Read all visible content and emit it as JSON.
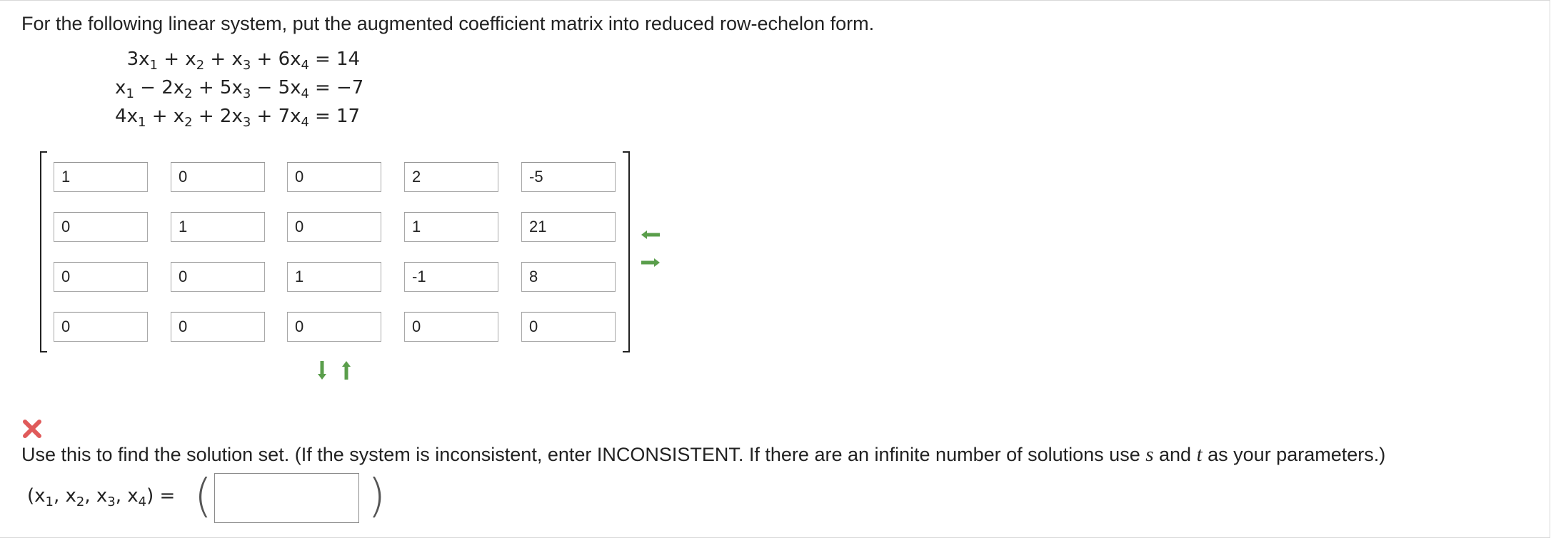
{
  "prompt": "For the following linear system, put the augmented coefficient matrix into reduced row-echelon form.",
  "system": {
    "equations": [
      {
        "lhs_html": "3x<span class='sub'>1</span> + x<span class='sub'>2</span> + x<span class='sub'>3</span> + 6x<span class='sub'>4</span>",
        "eq": "=",
        "rhs": "14"
      },
      {
        "lhs_html": "x<span class='sub'>1</span> − 2x<span class='sub'>2</span> + 5x<span class='sub'>3</span> − 5x<span class='sub'>4</span>",
        "eq": "=",
        "rhs": "−7"
      },
      {
        "lhs_html": "4x<span class='sub'>1</span> + x<span class='sub'>2</span> + 2x<span class='sub'>3</span> + 7x<span class='sub'>4</span>",
        "eq": "=",
        "rhs": "17"
      }
    ]
  },
  "matrix": {
    "rows": [
      [
        "1",
        "0",
        "0",
        "2",
        "-5"
      ],
      [
        "0",
        "1",
        "0",
        "1",
        "21"
      ],
      [
        "0",
        "0",
        "1",
        "-1",
        "8"
      ],
      [
        "0",
        "0",
        "0",
        "0",
        "0"
      ]
    ]
  },
  "controls": {
    "remove_column_icon": "left-arrow-icon",
    "add_column_icon": "right-arrow-icon",
    "add_row_icon": "down-arrow-icon",
    "remove_row_icon": "up-arrow-icon",
    "arrow_color": "#5a9e4b"
  },
  "feedback": {
    "icon": "incorrect-x-icon",
    "color": "#e05a5a"
  },
  "instruction": {
    "part1": "Use this to find the solution set. (If the system is inconsistent, enter INCONSISTENT. If there are an infinite number of solutions use ",
    "var_s": "s",
    "part2": " and ",
    "var_t": "t",
    "part3": " as your parameters.)"
  },
  "answer": {
    "label_html": "(x<span class='sub'>1</span>, x<span class='sub'>2</span>, x<span class='sub'>3</span>, x<span class='sub'>4</span>) =",
    "open_paren": "(",
    "close_paren": ")",
    "value": ""
  }
}
